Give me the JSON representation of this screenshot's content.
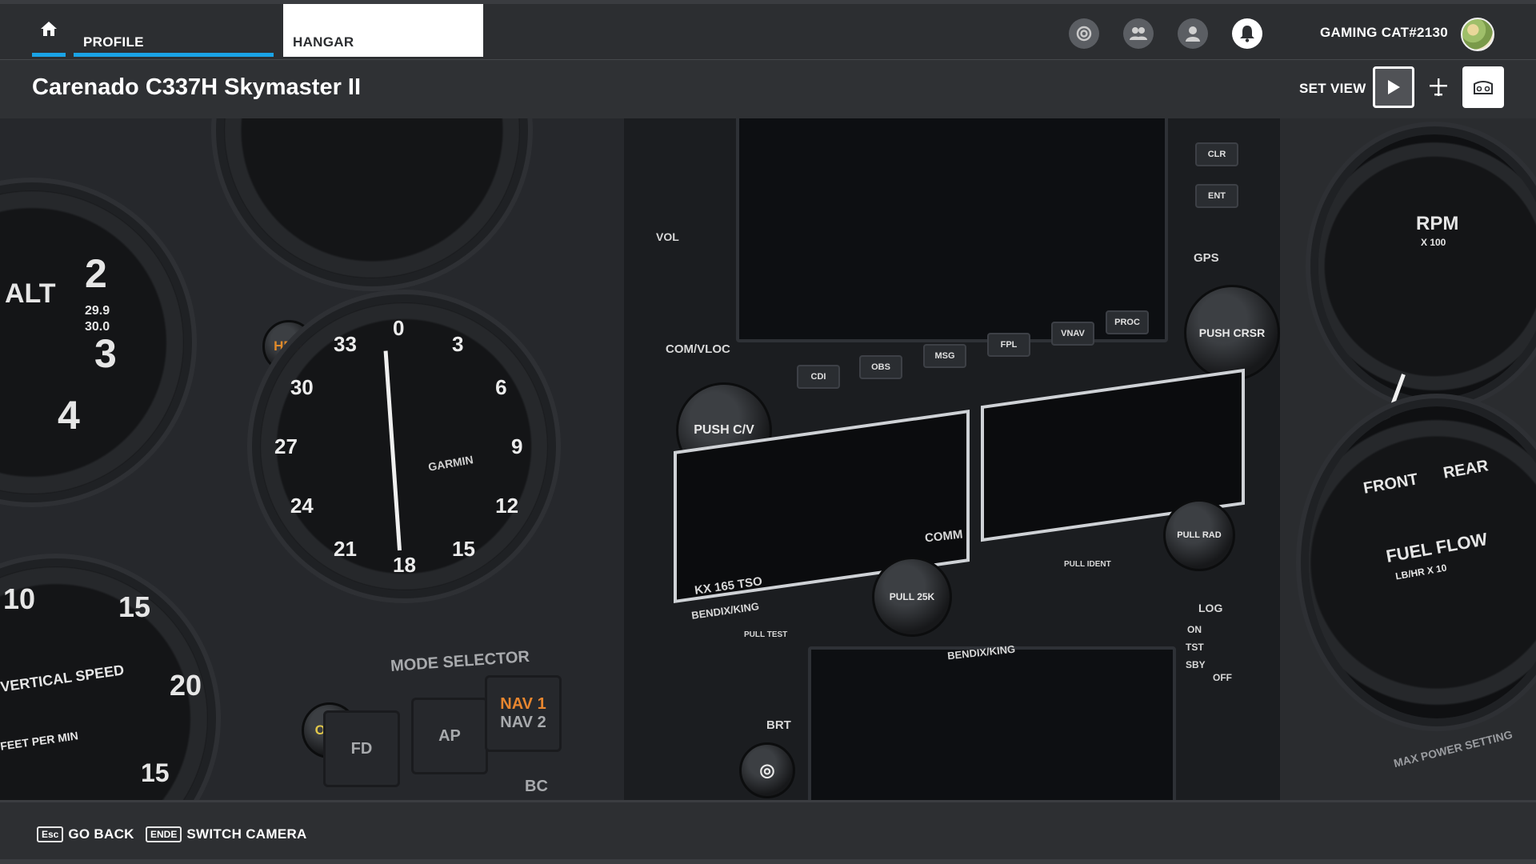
{
  "nav": {
    "home_icon": "home-icon",
    "tabs": [
      {
        "label": "PROFILE",
        "state": "active"
      },
      {
        "label": "HANGAR",
        "state": "hovered"
      }
    ],
    "icons": [
      "activity-icon",
      "friends-icon",
      "profile-icon",
      "notifications-icon"
    ],
    "user_name": "GAMING CAT#2130"
  },
  "header": {
    "title": "Carenado C337H Skymaster II",
    "set_view_label": "SET VIEW",
    "view_buttons": [
      "play-icon",
      "aircraft-icon",
      "panel-view-icon"
    ]
  },
  "cockpit": {
    "hdg_knob": "HDG",
    "obs_knob": "OBS",
    "alt_label": "ALT",
    "alt_digits": [
      "2",
      "3",
      "4"
    ],
    "alt_kollsman": [
      "29.9",
      "30.0"
    ],
    "hsi_marks": [
      "0",
      "3",
      "6",
      "9",
      "12",
      "15",
      "18",
      "21",
      "24",
      "27",
      "30",
      "33"
    ],
    "hsi_brand": "GARMIN",
    "vsi_label": "VERTICAL SPEED",
    "vsi_units": "FEET PER MIN",
    "vsi_marks": [
      "10",
      "15",
      "20",
      "15"
    ],
    "mode_selector_label": "MODE SELECTOR",
    "mode_buttons": [
      "FD",
      "AP",
      "NAV 1",
      "NAV 2",
      "BC"
    ],
    "gps_buttons": [
      "CDI",
      "OBS",
      "MSG",
      "FPL",
      "VNAV",
      "PROC"
    ],
    "gps_right_buttons": [
      "CLR",
      "ENT"
    ],
    "gps_label": "GPS",
    "com_vloc_label": "COM/VLOC",
    "vol_label": "VOL",
    "push_cv": "PUSH C/V",
    "push_crsr": "PUSH CRSR",
    "comm_label": "COMM",
    "radio_model": "KX 165 TSO",
    "bendix_label": "BENDIX/KING",
    "pull_25k": "PULL 25K",
    "pull_ident": "PULL IDENT",
    "pull_test": "PULL TEST",
    "pull_rad": "PULL RAD",
    "brt_label": "BRT",
    "log_label": "LOG",
    "log_positions": [
      "ON",
      "TST",
      "SBY",
      "OFF"
    ],
    "rpm_label": "RPM",
    "rpm_units": "X 100",
    "fuel_flow_label": "FUEL FLOW",
    "fuel_flow_units": "LB/HR X 10",
    "front_label": "FRONT",
    "rear_label": "REAR",
    "max_power": "MAX POWER SETTING"
  },
  "footer": {
    "hints": [
      {
        "key": "Esc",
        "label": "GO BACK"
      },
      {
        "key": "ENDE",
        "label": "SWITCH CAMERA"
      }
    ]
  },
  "colors": {
    "accent": "#1aa3e6",
    "topbar": "#2c2e31",
    "hdg_orange": "#e08a2a",
    "obs_yellow": "#e2c84a",
    "nav1_orange": "#e8862f"
  }
}
